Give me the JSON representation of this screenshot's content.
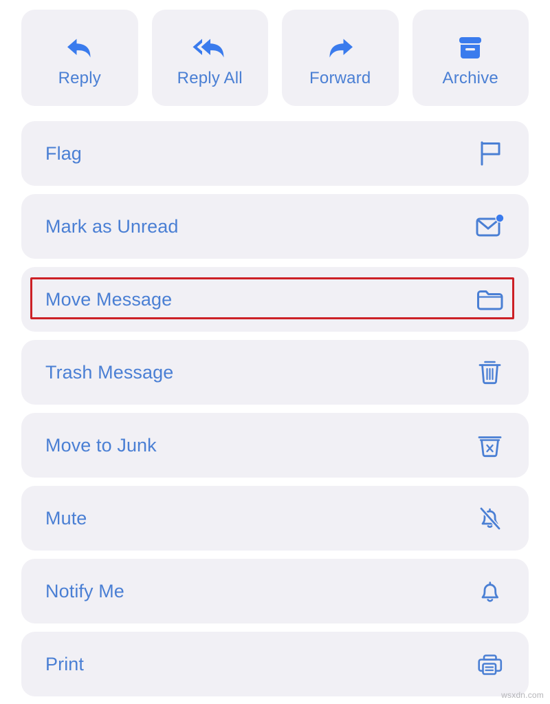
{
  "accent_blue_filled": "#3a7bed",
  "accent_blue_outline": "#4a7fd4",
  "row_background": "#f1f0f5",
  "highlight_color": "#cc2026",
  "quick_actions": [
    {
      "label": "Reply",
      "icon": "reply-arrow-icon"
    },
    {
      "label": "Reply All",
      "icon": "reply-all-arrow-icon"
    },
    {
      "label": "Forward",
      "icon": "forward-arrow-icon"
    },
    {
      "label": "Archive",
      "icon": "archive-box-icon"
    }
  ],
  "menu_rows": [
    {
      "label": "Flag",
      "icon": "flag-icon",
      "highlighted": false
    },
    {
      "label": "Mark as Unread",
      "icon": "envelope-badge-icon",
      "highlighted": false
    },
    {
      "label": "Move Message",
      "icon": "folder-icon",
      "highlighted": true
    },
    {
      "label": "Trash Message",
      "icon": "trash-icon",
      "highlighted": false
    },
    {
      "label": "Move to Junk",
      "icon": "junk-bin-x-icon",
      "highlighted": false
    },
    {
      "label": "Mute",
      "icon": "bell-slash-icon",
      "highlighted": false
    },
    {
      "label": "Notify Me",
      "icon": "bell-icon",
      "highlighted": false
    },
    {
      "label": "Print",
      "icon": "printer-icon",
      "highlighted": false
    }
  ],
  "watermark": "wsxdn.com"
}
